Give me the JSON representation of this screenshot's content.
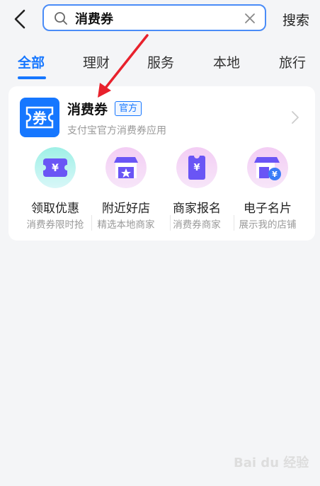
{
  "header": {
    "back_icon": "chevron-left-icon",
    "search": {
      "value": "消费券",
      "icon": "search-icon",
      "clear_icon": "close-icon"
    },
    "search_button": "搜索"
  },
  "tabs": [
    {
      "label": "全部",
      "active": true
    },
    {
      "label": "理财",
      "active": false
    },
    {
      "label": "服务",
      "active": false
    },
    {
      "label": "本地",
      "active": false
    },
    {
      "label": "旅行",
      "active": false
    }
  ],
  "app": {
    "logo_text": "券",
    "name": "消费券",
    "badge": "官方",
    "description": "支付宝官方消费券应用",
    "chevron": "chevron-right-icon"
  },
  "services": [
    {
      "title": "领取优惠",
      "subtitle": "消费券限时抢",
      "icon": "coupon-icon"
    },
    {
      "title": "附近好店",
      "subtitle": "精选本地商家",
      "icon": "storefront-star-icon"
    },
    {
      "title": "商家报名",
      "subtitle": "消费券商家",
      "icon": "ticket-yen-icon"
    },
    {
      "title": "电子名片",
      "subtitle": "展示我的店铺",
      "icon": "shop-card-icon"
    }
  ],
  "watermark": "Bai du 经验",
  "colors": {
    "accent": "#1677ff",
    "annotation_arrow": "#e8212c",
    "background": "#f4f5f7"
  }
}
